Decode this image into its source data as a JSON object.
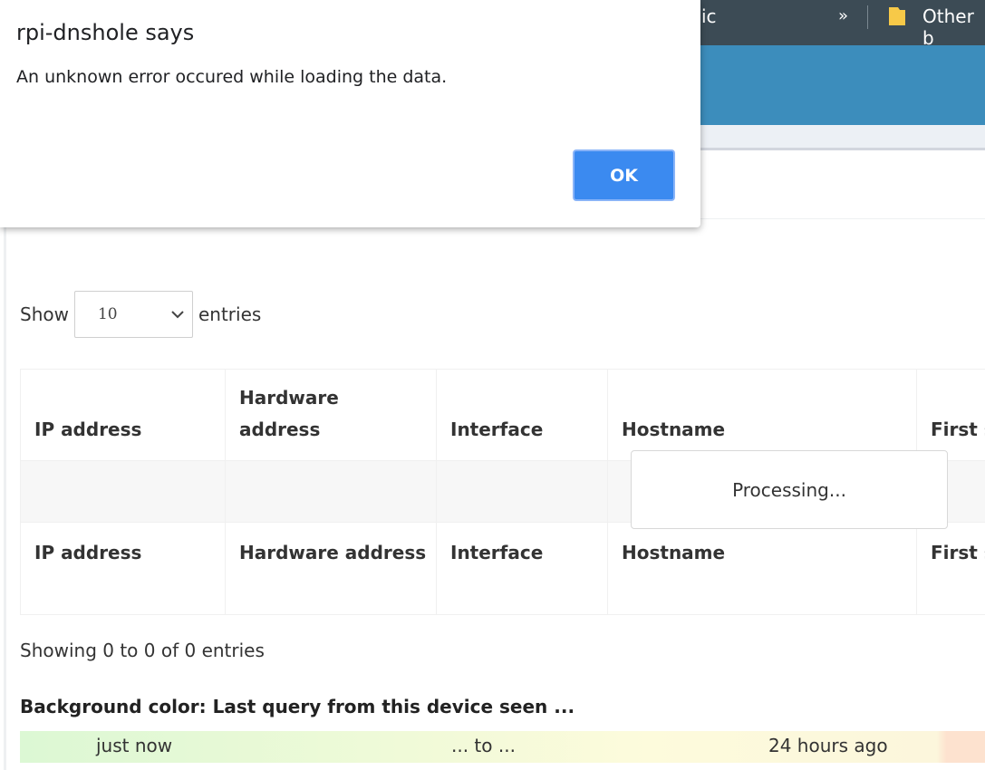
{
  "browser": {
    "tab_fragment": "ic",
    "overflow_label": "»",
    "bookmark_folder": "Other b"
  },
  "dialog": {
    "title": "rpi-dnshole says",
    "message": "An unknown error occured while loading the data.",
    "ok_label": "OK"
  },
  "length_menu": {
    "prefix": "Show",
    "value": "10",
    "suffix": "entries"
  },
  "table": {
    "headers": [
      "IP address",
      "Hardware address",
      "Interface",
      "Hostname",
      "First s"
    ],
    "footers": [
      "IP address",
      "Hardware address",
      "Interface",
      "Hostname",
      "First s"
    ],
    "processing": "Processing..."
  },
  "info": "Showing 0 to 0 of 0 entries",
  "legend": {
    "title": "Background color: Last query from this device seen ...",
    "start": "just now",
    "middle": "... to ...",
    "end": "24 hours ago"
  }
}
